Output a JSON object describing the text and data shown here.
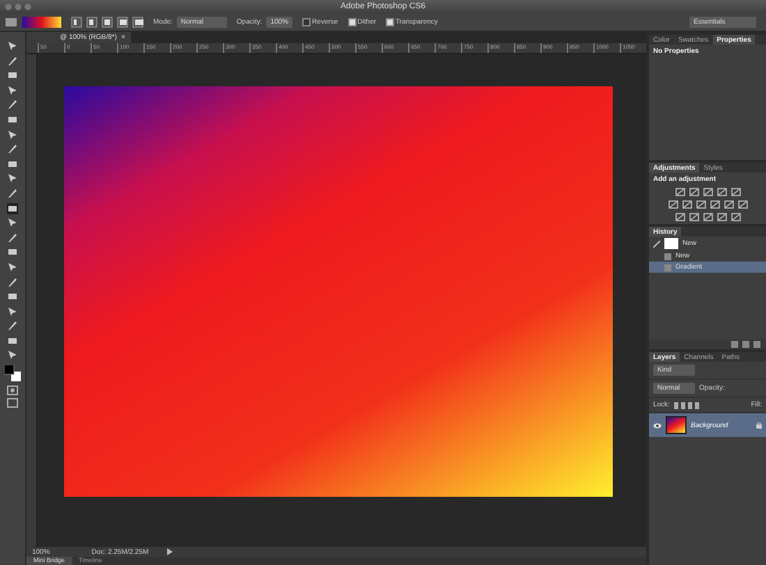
{
  "window": {
    "title": "Adobe Photoshop CS6"
  },
  "options_bar": {
    "mode_label": "Mode:",
    "mode": "Normal",
    "opacity_label": "Opacity:",
    "opacity": "100%",
    "checkboxes": [
      {
        "label": "Reverse",
        "checked": false
      },
      {
        "label": "Dither",
        "checked": true
      },
      {
        "label": "Transparency",
        "checked": true
      }
    ],
    "workspace": "Essentials"
  },
  "document_tab": {
    "title": "@ 100% (RGB/8*)",
    "close": "×"
  },
  "ruler": [
    "50",
    "0",
    "50",
    "100",
    "150",
    "200",
    "250",
    "300",
    "350",
    "400",
    "450",
    "500",
    "550",
    "600",
    "650",
    "700",
    "750",
    "800",
    "850",
    "900",
    "950",
    "1000",
    "1050"
  ],
  "properties_panel": {
    "tabs": [
      {
        "label": "Color",
        "selected": false
      },
      {
        "label": "Swatches",
        "selected": false
      },
      {
        "label": "Properties",
        "selected": true
      }
    ],
    "text": "No Properties"
  },
  "adjustments_panel": {
    "tabs": [
      {
        "label": "Adjustments",
        "selected": true
      },
      {
        "label": "Styles",
        "selected": false
      }
    ],
    "text": "Add an adjustment"
  },
  "history_panel": {
    "tabs": [
      {
        "label": "History",
        "selected": true
      }
    ],
    "items": [
      {
        "kind": "snapshot",
        "label": "New",
        "selected": false
      },
      {
        "kind": "step",
        "label": "New",
        "selected": false
      },
      {
        "kind": "step",
        "label": "Gradient",
        "selected": true
      }
    ]
  },
  "layers_panel": {
    "tabs": [
      {
        "label": "Layers",
        "selected": true
      },
      {
        "label": "Channels",
        "selected": false
      },
      {
        "label": "Paths",
        "selected": false
      }
    ],
    "filter": "Kind",
    "blend_mode": "Normal",
    "opacity_label": "Opacity:",
    "lock_label": "Lock:",
    "fill_label": "Fill:",
    "layers": [
      {
        "name": "Background",
        "selected": true,
        "visible": true,
        "locked": true
      }
    ]
  },
  "status_bar": {
    "zoom": "100%",
    "doc": "Doc: 2.25M/2.25M"
  },
  "bottom_tabs": [
    {
      "label": "Mini Bridge",
      "selected": true
    },
    {
      "label": "Timeline",
      "selected": false
    }
  ]
}
